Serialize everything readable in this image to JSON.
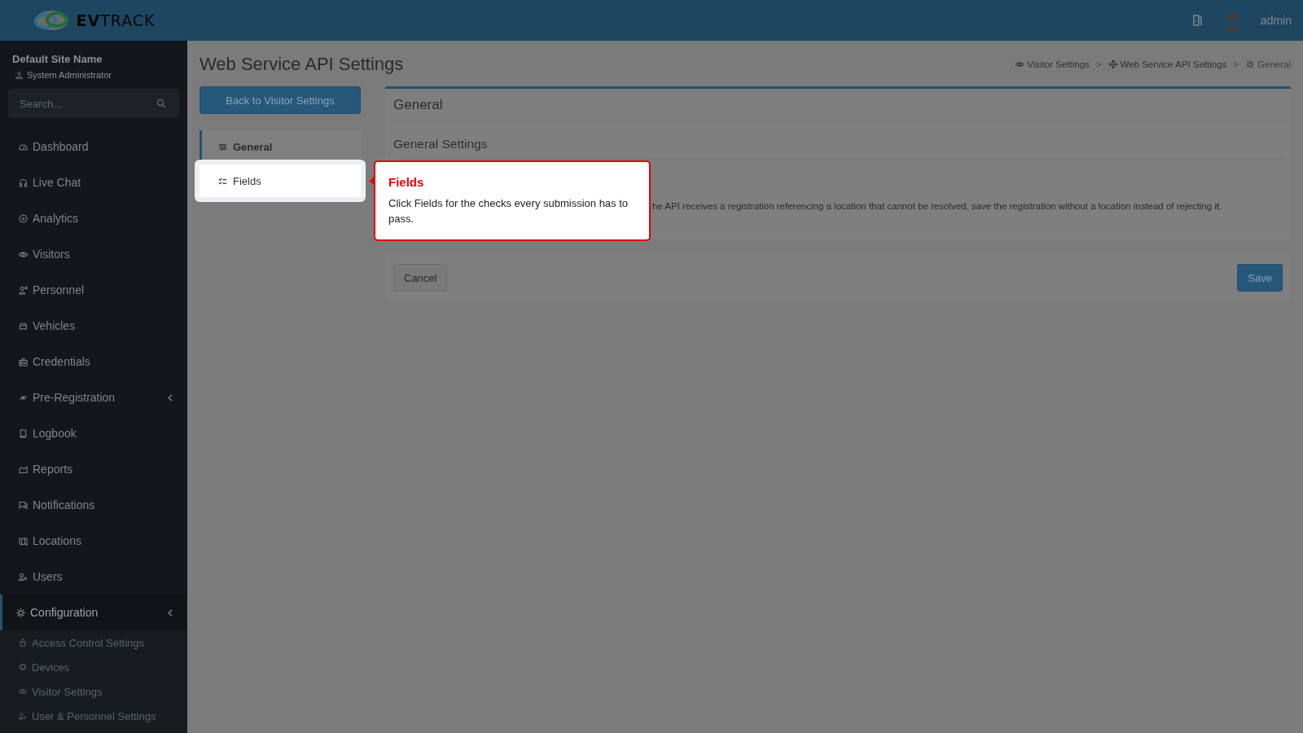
{
  "logo": {
    "text_bold": "EV",
    "text_light": "TRACK"
  },
  "topbar": {
    "user": "admin"
  },
  "sidebar": {
    "site": "Default Site Name",
    "role": "System Administrator",
    "search": {
      "placeholder": "Search..."
    },
    "items": [
      {
        "label": "Dashboard",
        "selected": false
      },
      {
        "label": "Live Chat",
        "selected": false
      },
      {
        "label": "Analytics",
        "selected": false
      },
      {
        "label": "Visitors",
        "selected": false
      },
      {
        "label": "Personnel",
        "selected": false
      },
      {
        "label": "Vehicles",
        "selected": false
      },
      {
        "label": "Credentials",
        "selected": false
      },
      {
        "label": "Pre-Registration",
        "selected": false,
        "expandable": true
      },
      {
        "label": "Logbook",
        "selected": false
      },
      {
        "label": "Reports",
        "selected": false
      },
      {
        "label": "Notifications",
        "selected": false
      },
      {
        "label": "Locations",
        "selected": false
      },
      {
        "label": "Users",
        "selected": false
      },
      {
        "label": "Configuration",
        "selected": true,
        "expandable": true,
        "children": [
          {
            "label": "Access Control Settings"
          },
          {
            "label": "Devices"
          },
          {
            "label": "Visitor Settings"
          },
          {
            "label": "User & Personnel Settings"
          }
        ]
      }
    ]
  },
  "page": {
    "title": "Web Service API Settings",
    "breadcrumbs": [
      {
        "label": "Visitor Settings"
      },
      {
        "separator": ">",
        "label": "Web Service API Settings"
      },
      {
        "separator": ">",
        "label": "General"
      }
    ],
    "back_button": "Back to Visitor Settings",
    "tabs": [
      {
        "label": "General",
        "selected": true,
        "highlighted": false
      },
      {
        "label": "Fields",
        "selected": false,
        "highlighted": true
      }
    ],
    "card": {
      "title": "General",
      "section": "General Settings",
      "description": "he API receives a registration referencing a location that cannot be resolved, save the registration without a location instead of rejecting it."
    },
    "buttons": {
      "cancel": "Cancel",
      "save": "Save"
    }
  },
  "tooltip": {
    "title": "Fields",
    "text": "Click Fields for the checks every submission has to pass."
  }
}
